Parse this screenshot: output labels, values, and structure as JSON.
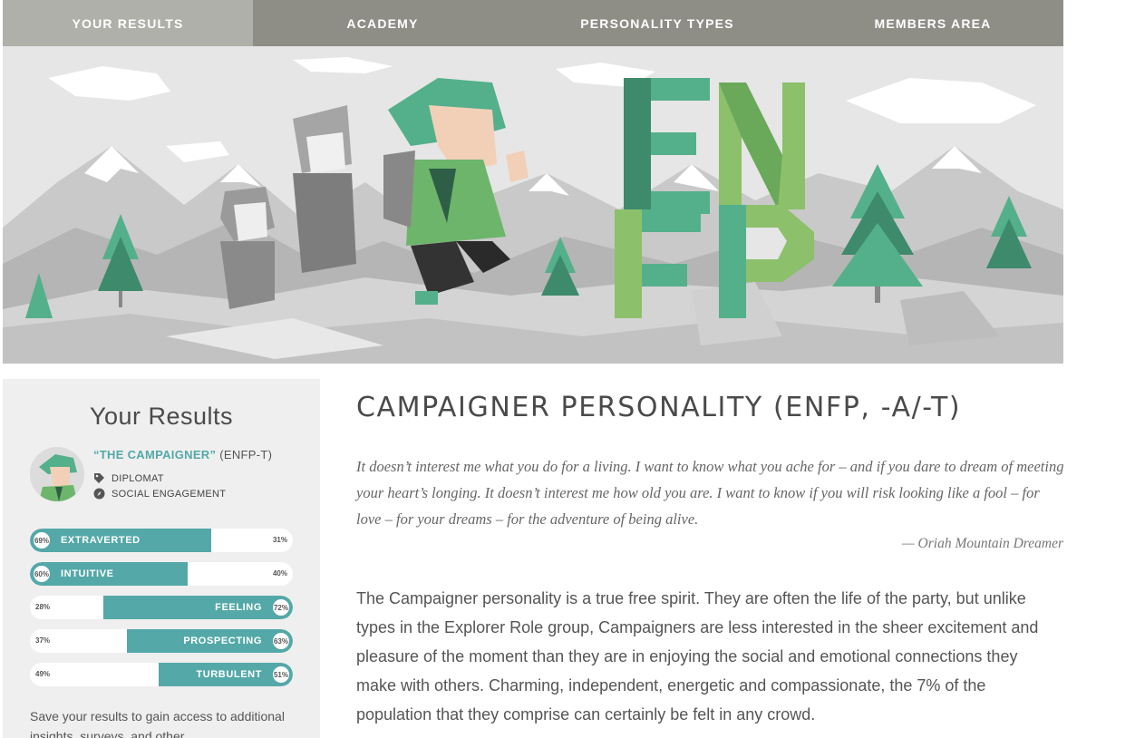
{
  "nav": {
    "items": [
      {
        "label": "YOUR RESULTS"
      },
      {
        "label": "ACADEMY"
      },
      {
        "label": "PERSONALITY TYPES"
      },
      {
        "label": "MEMBERS AREA"
      }
    ]
  },
  "hero": {
    "letters": [
      "E",
      "N",
      "F",
      "P"
    ],
    "colors": {
      "primary_green": "#54b08a",
      "light_green": "#8cc06a",
      "dark_green": "#3e8a6c",
      "sky": "#e6e6e6"
    }
  },
  "sidebar": {
    "title": "Your Results",
    "type_name": "“THE CAMPAIGNER”",
    "type_code": "(ENFP-T)",
    "role": "DIPLOMAT",
    "strategy": "SOCIAL ENGAGEMENT",
    "traits": [
      {
        "label": "EXTRAVERTED",
        "percent_text": "69%",
        "other_text": "31%",
        "value": 69,
        "side": "left"
      },
      {
        "label": "INTUITIVE",
        "percent_text": "60%",
        "other_text": "40%",
        "value": 60,
        "side": "left"
      },
      {
        "label": "FEELING",
        "percent_text": "72%",
        "other_text": "28%",
        "value": 72,
        "side": "right"
      },
      {
        "label": "PROSPECTING",
        "percent_text": "63%",
        "other_text": "37%",
        "value": 63,
        "side": "right"
      },
      {
        "label": "TURBULENT",
        "percent_text": "51%",
        "other_text": "49%",
        "value": 51,
        "side": "right"
      }
    ],
    "save_text": "Save your results to gain access to additional insights, surveys, and other"
  },
  "main": {
    "title": "CAMPAIGNER PERSONALITY (ENFP, -A/-T)",
    "quote": "It doesn’t interest me what you do for a living. I want to know what you ache for – and if you dare to dream of meeting your heart’s longing. It doesn’t interest me how old you are. I want to know if you will risk looking like a fool – for love – for your dreams – for the adventure of being alive.",
    "quote_author": "— Oriah Mountain Dreamer",
    "body": "The Campaigner personality is a true free spirit. They are often the life of the party, but unlike types in the Explorer Role group, Campaigners are less interested in the sheer excitement and pleasure of the moment than they are in enjoying the social and emotional connections they make with others. Charming, independent, energetic and compassionate, the 7% of the population that they comprise can certainly be felt in any crowd."
  },
  "colors": {
    "accent": "#54a8a8",
    "nav_bg": "#8e8e87",
    "nav_active": "#b0b0aa",
    "sidebar_bg": "#efefef"
  }
}
